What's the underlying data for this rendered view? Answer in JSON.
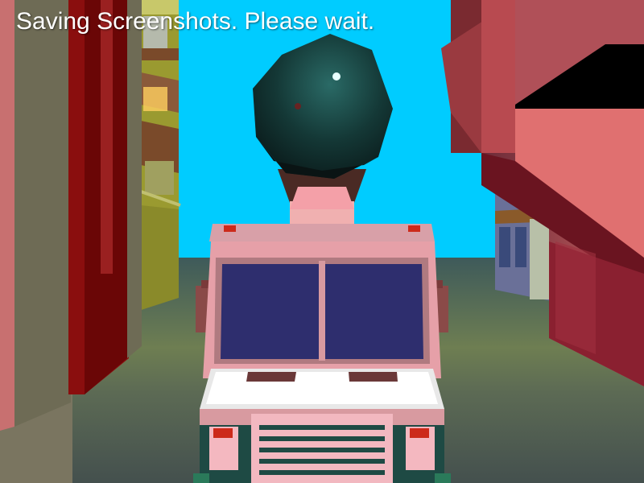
{
  "hud": {
    "status_message": "Saving Screenshots. Please wait."
  },
  "scene": {
    "sky_color": "#00ccff",
    "road_color": "#4a5a56",
    "vehicle": {
      "type": "ice-cream-van",
      "body_color": "#e6a0a8",
      "windshield_color": "#2e2e6e",
      "hood_color": "#ffffff",
      "grille_color": "#f2b8c0"
    },
    "driver_icon": "balloon-head-icon",
    "left_building_icon": "building-icon",
    "right_building_icon": "building-icon"
  }
}
